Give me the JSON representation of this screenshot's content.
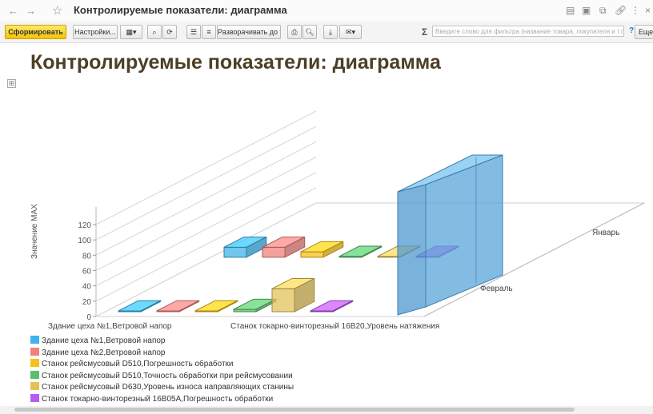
{
  "window": {
    "back": "←",
    "forward": "→",
    "star": "☆",
    "title": "Контролируемые показатели: диаграмма",
    "icons": [
      "printer-icon",
      "document-icon",
      "link-icon",
      "more-vert-icon",
      "close-icon"
    ],
    "more": "⋮",
    "close": "×"
  },
  "toolbar": {
    "generate": "Сформировать",
    "settings": "Настройки...",
    "expand_to": "Разворачивать до",
    "filter_placeholder": "Введите слово для фильтра (название товара, покупателя и т.п.)",
    "sigma": "Σ",
    "help": "?",
    "more": "Еще"
  },
  "report": {
    "title": "Контролируемые показатели: диаграмма",
    "expand_symbol": "⊞"
  },
  "chart_data": {
    "type": "bar",
    "title": "",
    "ylabel": "Значение MAX",
    "ylim": [
      0,
      120
    ],
    "yticks": [
      "120",
      "100",
      "80",
      "60",
      "40",
      "20",
      "0"
    ],
    "x_labels": [
      "Здание цеха №1,Ветровой напор",
      "Станок токарно-винторезный 16В20,Уровень натяжения"
    ],
    "depth_labels": [
      "Январь",
      "Февраль"
    ],
    "series": [
      {
        "name": "Здание цеха №1,Ветровой напор",
        "color": "#3fb4ea",
        "values": [
          13,
          0
        ]
      },
      {
        "name": "Здание цеха №2,Ветровой напор",
        "color": "#f0817e",
        "values": [
          13,
          0
        ]
      },
      {
        "name": "Станок рейсмусовый D510,Погрешность обработки",
        "color": "#f7c01a",
        "values": [
          7,
          0
        ]
      },
      {
        "name": "Станок рейсмусовый D510,Точность обработки при рейсмусовании",
        "color": "#5cbf6e",
        "values": [
          0,
          3
        ]
      },
      {
        "name": "Станок рейсмусовый D630,Уровень износа направляющих станины",
        "color": "#e2c35a",
        "values": [
          0,
          30
        ]
      },
      {
        "name": "Станок токарно-винторезный 16В05А,Погрешность обработки",
        "color": "#b85bf2",
        "values": [
          0,
          0
        ]
      }
    ],
    "grid": true,
    "legend_position": "bottom-left"
  }
}
